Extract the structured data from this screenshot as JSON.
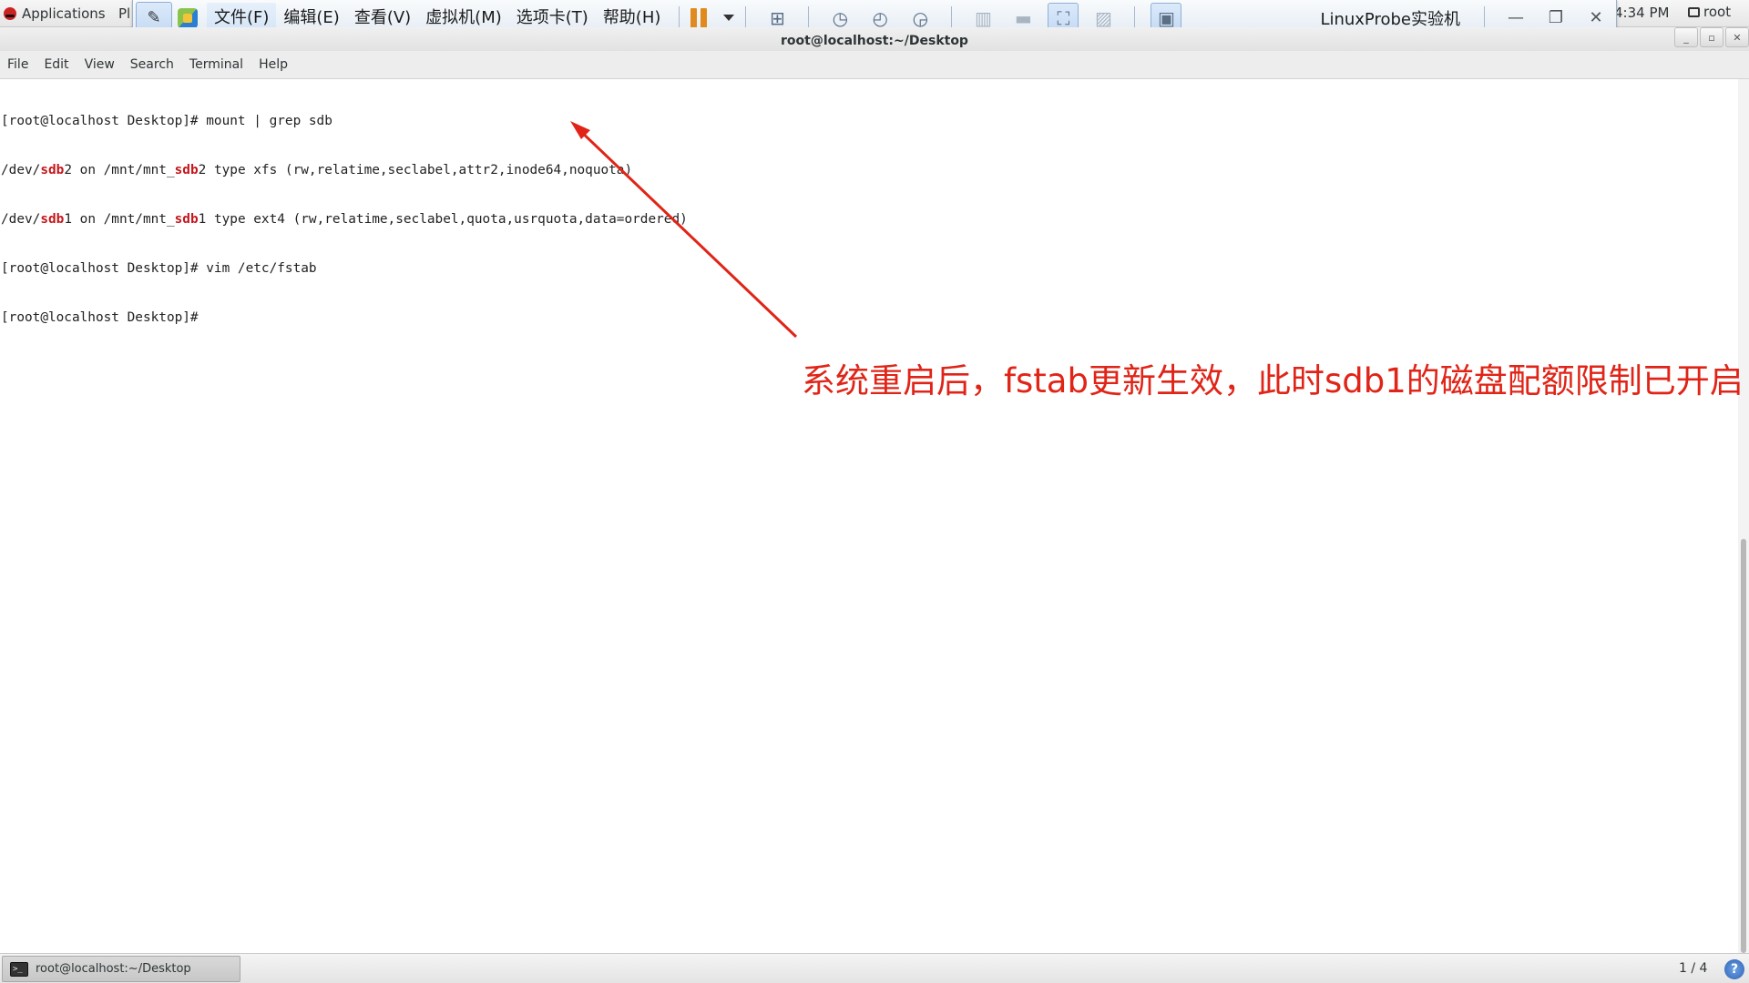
{
  "gnome_topbar": {
    "applications_label": "Applications",
    "places_partial": "Pl",
    "clock": "4:34 PM",
    "user": "root"
  },
  "vmware_toolbar": {
    "menu": [
      "文件(F)",
      "编辑(E)",
      "查看(V)",
      "虚拟机(M)",
      "选项卡(T)",
      "帮助(H)"
    ],
    "vm_name": "LinuxProbe实验机"
  },
  "terminal": {
    "window_title": "root@localhost:~/Desktop",
    "menu": [
      "File",
      "Edit",
      "View",
      "Search",
      "Terminal",
      "Help"
    ],
    "lines": [
      [
        "[root@localhost Desktop]# mount | grep sdb"
      ],
      [
        "/dev/",
        "sdb",
        "2 on /mnt/mnt_",
        "sdb",
        "2 type xfs (rw,relatime,seclabel,attr2,inode64,noquota)"
      ],
      [
        "/dev/",
        "sdb",
        "1 on /mnt/mnt_",
        "sdb",
        "1 type ext4 (rw,relatime,seclabel,quota,usrquota,data=ordered)"
      ],
      [
        "[root@localhost Desktop]# vim /etc/fstab"
      ],
      [
        "[root@localhost Desktop]# "
      ]
    ]
  },
  "annotation": {
    "text": "系统重启后，fstab更新生效，此时sdb1的磁盘配额限制已开启",
    "color": "#e02417"
  },
  "taskbar": {
    "task_label": "root@localhost:~/Desktop",
    "workspace": "1 / 4"
  }
}
